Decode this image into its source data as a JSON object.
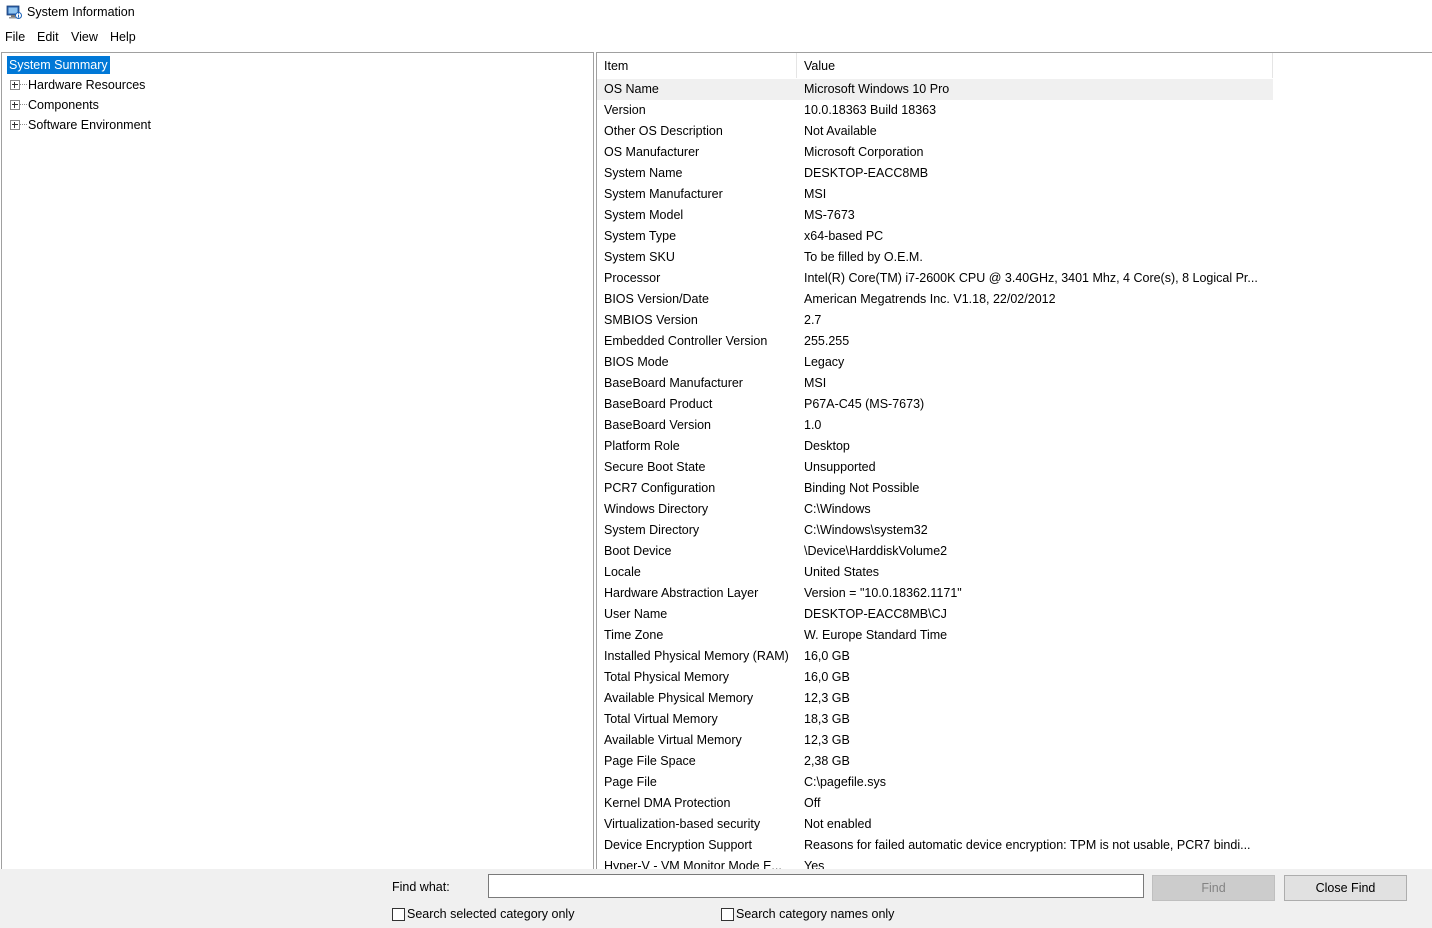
{
  "window": {
    "title": "System Information",
    "icon": "system-information-icon"
  },
  "menu": [
    "File",
    "Edit",
    "View",
    "Help"
  ],
  "tree": {
    "root": "System Summary",
    "children": [
      "Hardware Resources",
      "Components",
      "Software Environment"
    ]
  },
  "table": {
    "headers": {
      "item": "Item",
      "value": "Value"
    },
    "selected_row": 0,
    "rows": [
      [
        "OS Name",
        "Microsoft Windows 10 Pro"
      ],
      [
        "Version",
        "10.0.18363 Build 18363"
      ],
      [
        "Other OS Description",
        "Not Available"
      ],
      [
        "OS Manufacturer",
        "Microsoft Corporation"
      ],
      [
        "System Name",
        "DESKTOP-EACC8MB"
      ],
      [
        "System Manufacturer",
        "MSI"
      ],
      [
        "System Model",
        "MS-7673"
      ],
      [
        "System Type",
        "x64-based PC"
      ],
      [
        "System SKU",
        "To be filled by O.E.M."
      ],
      [
        "Processor",
        "Intel(R) Core(TM) i7-2600K CPU @ 3.40GHz, 3401 Mhz, 4 Core(s), 8 Logical Pr..."
      ],
      [
        "BIOS Version/Date",
        "American Megatrends Inc. V1.18, 22/02/2012"
      ],
      [
        "SMBIOS Version",
        "2.7"
      ],
      [
        "Embedded Controller Version",
        "255.255"
      ],
      [
        "BIOS Mode",
        "Legacy"
      ],
      [
        "BaseBoard Manufacturer",
        "MSI"
      ],
      [
        "BaseBoard Product",
        "P67A-C45 (MS-7673)"
      ],
      [
        "BaseBoard Version",
        "1.0"
      ],
      [
        "Platform Role",
        "Desktop"
      ],
      [
        "Secure Boot State",
        "Unsupported"
      ],
      [
        "PCR7 Configuration",
        "Binding Not Possible"
      ],
      [
        "Windows Directory",
        "C:\\Windows"
      ],
      [
        "System Directory",
        "C:\\Windows\\system32"
      ],
      [
        "Boot Device",
        "\\Device\\HarddiskVolume2"
      ],
      [
        "Locale",
        "United States"
      ],
      [
        "Hardware Abstraction Layer",
        "Version = \"10.0.18362.1171\""
      ],
      [
        "User Name",
        "DESKTOP-EACC8MB\\CJ"
      ],
      [
        "Time Zone",
        "W. Europe Standard Time"
      ],
      [
        "Installed Physical Memory (RAM)",
        "16,0 GB"
      ],
      [
        "Total Physical Memory",
        "16,0 GB"
      ],
      [
        "Available Physical Memory",
        "12,3 GB"
      ],
      [
        "Total Virtual Memory",
        "18,3 GB"
      ],
      [
        "Available Virtual Memory",
        "12,3 GB"
      ],
      [
        "Page File Space",
        "2,38 GB"
      ],
      [
        "Page File",
        "C:\\pagefile.sys"
      ],
      [
        "Kernel DMA Protection",
        "Off"
      ],
      [
        "Virtualization-based security",
        "Not enabled"
      ],
      [
        "Device Encryption Support",
        "Reasons for failed automatic device encryption: TPM is not usable, PCR7 bindi..."
      ],
      [
        "Hyper-V - VM Monitor Mode E...",
        "Yes"
      ]
    ]
  },
  "find": {
    "label": "Find what:",
    "value": "",
    "find_button": "Find",
    "close_button": "Close Find",
    "option1": "Search selected category only",
    "option2": "Search category names only"
  },
  "colors": {
    "selection": "#0078d7",
    "row_highlight": "#f0f0f0",
    "findbar_bg": "#f0f0f0"
  }
}
